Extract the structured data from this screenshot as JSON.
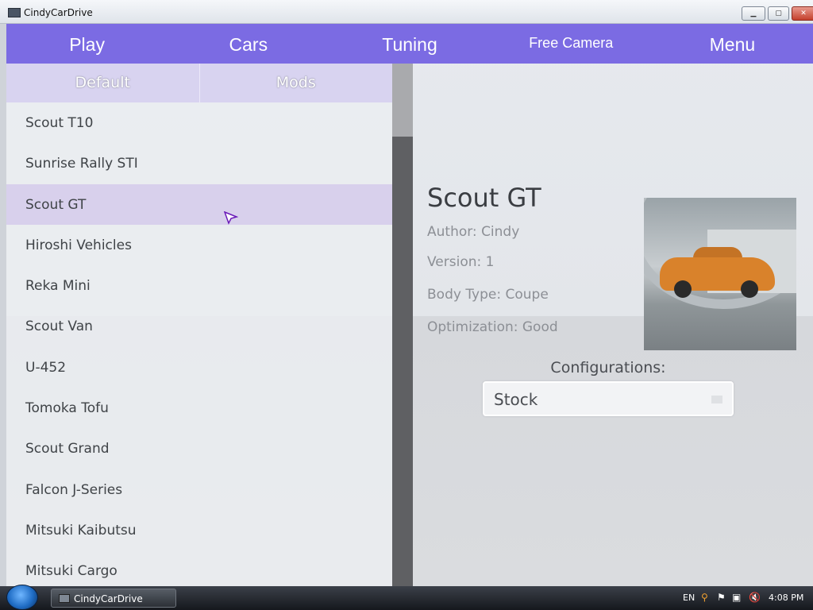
{
  "window": {
    "title": "CindyCarDrive"
  },
  "nav": [
    {
      "label": "Play"
    },
    {
      "label": "Cars"
    },
    {
      "label": "Tuning"
    },
    {
      "label": "Free Camera"
    },
    {
      "label": "Menu"
    }
  ],
  "tabs": [
    {
      "label": "Default"
    },
    {
      "label": "Mods"
    }
  ],
  "cars": [
    "Scout T10",
    "Sunrise Rally STI",
    "Scout GT",
    "Hiroshi Vehicles",
    "Reka Mini",
    "Scout Van",
    "U-452",
    "Tomoka Tofu",
    "Scout Grand",
    "Falcon J-Series",
    "Mitsuki Kaibutsu",
    "Mitsuki Cargo"
  ],
  "selected_index": 2,
  "details": {
    "name": "Scout GT",
    "author": "Author: Cindy",
    "version": "Version: 1",
    "body_type": "Body Type: Coupe",
    "optimization": "Optimization: Good",
    "configurations_label": "Configurations:",
    "configuration_value": "Stock"
  },
  "taskbar": {
    "app_label": "CindyCarDrive",
    "language": "EN",
    "clock": "4:08 PM"
  },
  "colors": {
    "accent": "#7b6be3",
    "selected_row": "#d8d0ec"
  }
}
